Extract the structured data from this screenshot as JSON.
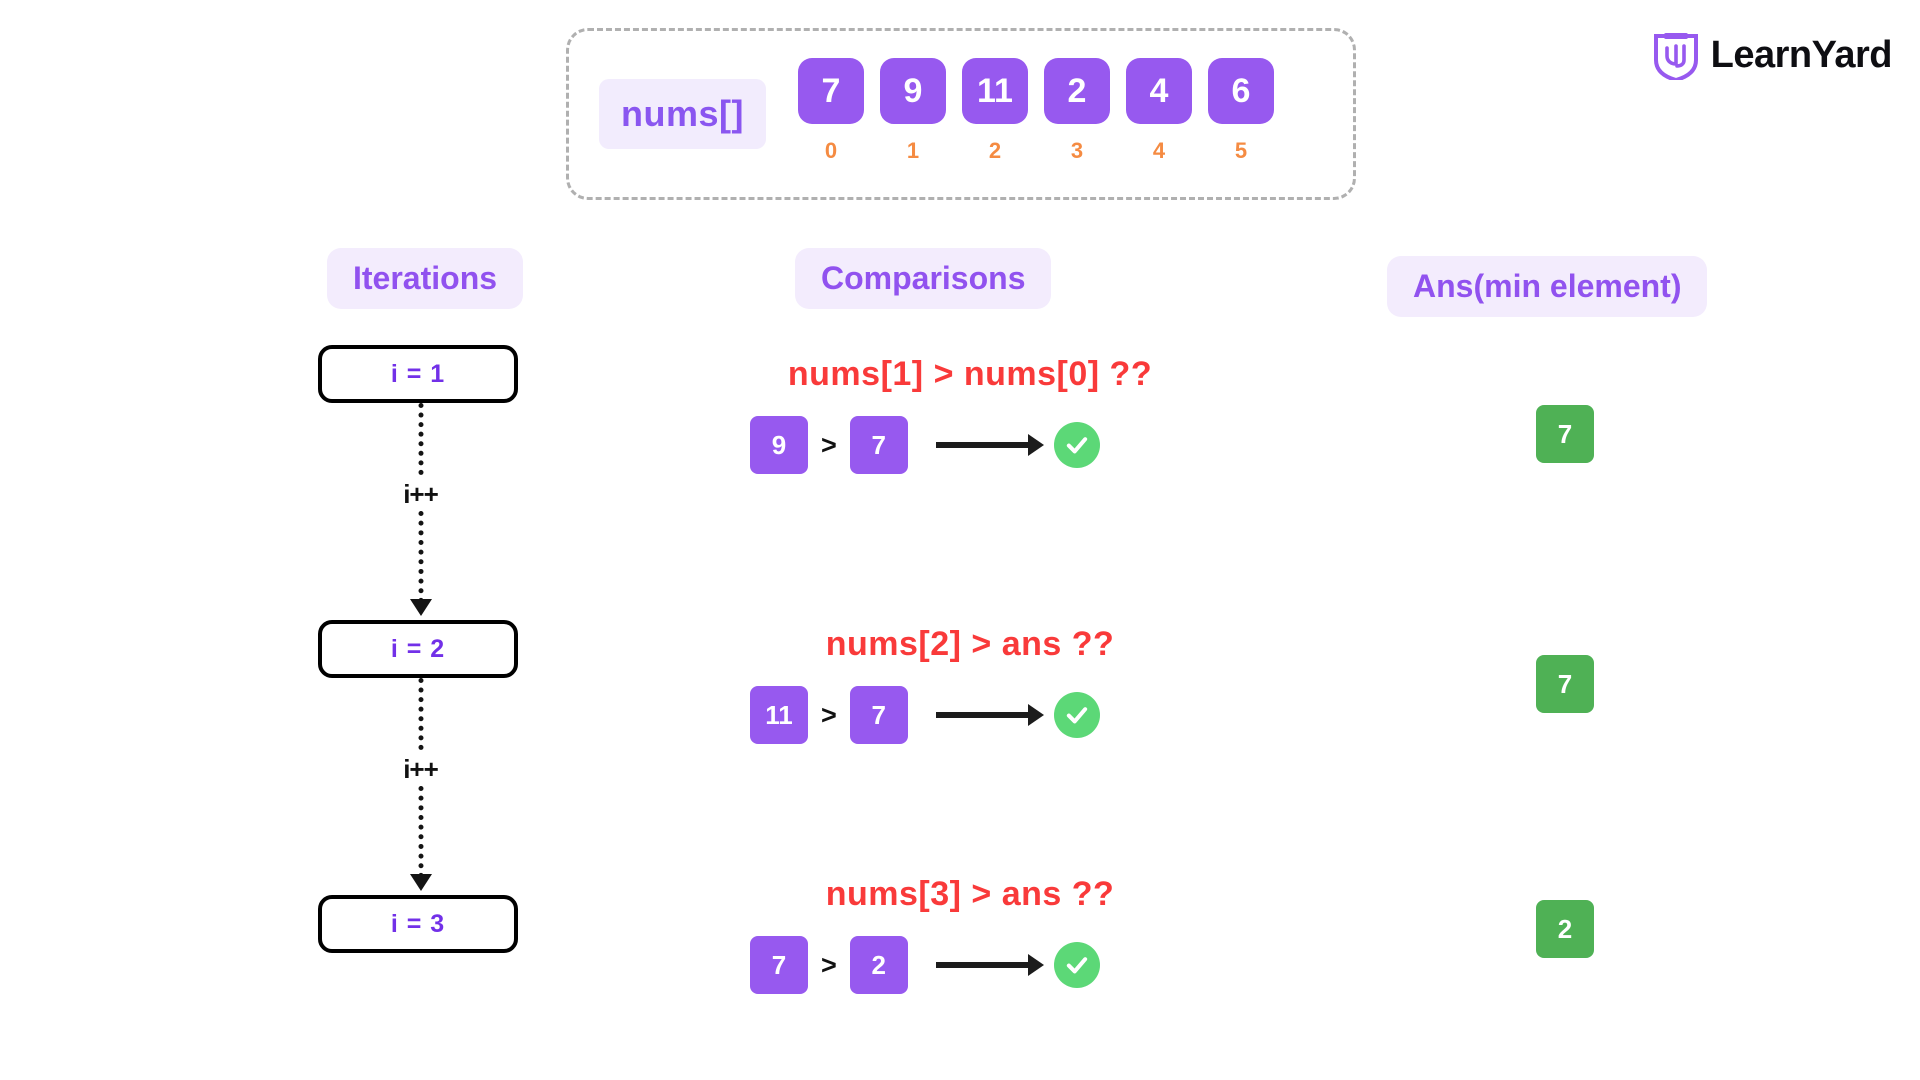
{
  "logo": {
    "name": "LearnYard",
    "mark": "shield-ly-monogram",
    "mark_color": "#9759ef",
    "text_color": "#0e0e12"
  },
  "array_panel": {
    "label": "nums[]",
    "values": [
      "7",
      "9",
      "11",
      "2",
      "4",
      "6"
    ],
    "indices": [
      "0",
      "1",
      "2",
      "3",
      "4",
      "5"
    ],
    "cell_color": "#9759ef",
    "index_color": "#f58b42",
    "border_color": "#b0b0b0"
  },
  "headers": {
    "iterations": "Iterations",
    "comparisons": "Comparisons",
    "ans": "Ans(min element)",
    "pill_bg": "#f3ecfd",
    "pill_text": "#9152ef"
  },
  "iterations": {
    "boxes": [
      {
        "label": "i = 1"
      },
      {
        "label": "i = 2"
      },
      {
        "label": "i = 3"
      }
    ],
    "transition_label": "i++",
    "text_color": "#7230e8"
  },
  "comparisons": {
    "rows": [
      {
        "question": "nums[1] > nums[0] ??",
        "left": "9",
        "operator": ">",
        "right": "7",
        "result_icon": "check-icon",
        "result": "true"
      },
      {
        "question": "nums[2] > ans ??",
        "left": "11",
        "operator": ">",
        "right": "7",
        "result_icon": "check-icon",
        "result": "true"
      },
      {
        "question": "nums[3] > ans ??",
        "left": "7",
        "operator": ">",
        "right": "2",
        "result_icon": "check-icon",
        "result": "true"
      }
    ],
    "question_color": "#f93a3a",
    "tile_color": "#9759ef",
    "check_color": "#5cd877"
  },
  "ans": {
    "values": [
      "7",
      "7",
      "2"
    ],
    "box_color": "#4fb155"
  }
}
